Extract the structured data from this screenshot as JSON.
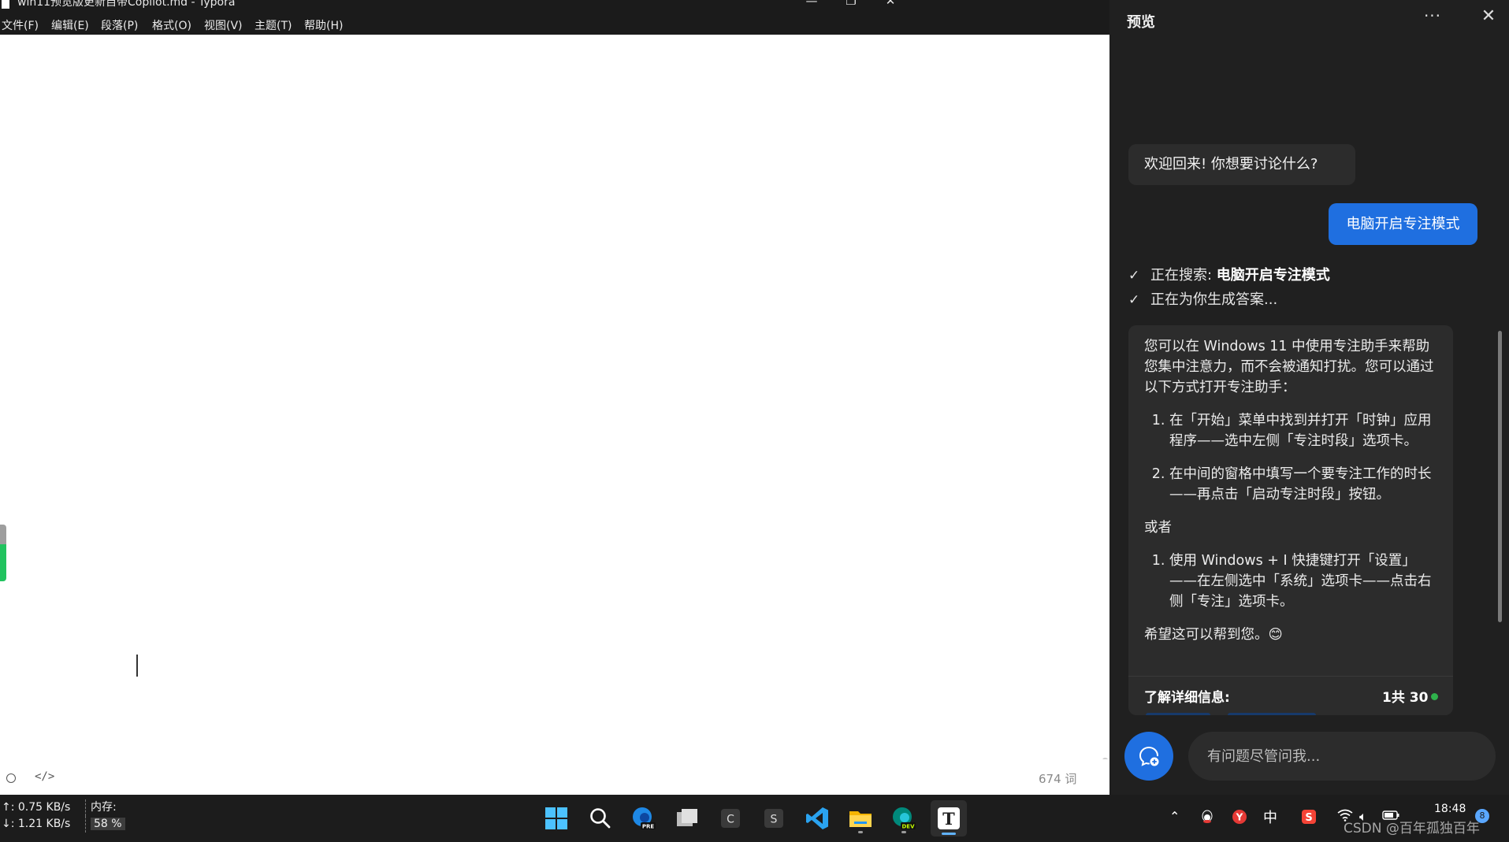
{
  "typora": {
    "title": "win11预览版更新自带Copilot.md - Typora",
    "window_buttons": {
      "minimize": "—",
      "restore": "❐",
      "close": "✕"
    },
    "menu": [
      "文件(F)",
      "编辑(E)",
      "段落(P)",
      "格式(O)",
      "视图(V)",
      "主题(T)",
      "帮助(H)"
    ],
    "word_count": "674 词",
    "code_toggle": "</>"
  },
  "copilot": {
    "title": "预览",
    "more": "···",
    "close": "✕",
    "welcome": "欢迎回来! 你想要讨论什么?",
    "user_message": "电脑开启专注模式",
    "status": {
      "searching_prefix": "正在搜索: ",
      "searching_query": "电脑开启专注模式",
      "generating": "正在为你生成答案..."
    },
    "answer": {
      "intro": "您可以在 Windows 11 中使用专注助手来帮助您集中注意力，而不会被通知打扰。您可以通过以下方式打开专注助手：",
      "list1": [
        "在「开始」菜单中找到并打开「时钟」应用程序——选中左侧「专注时段」选项卡。",
        "在中间的窗格中填写一个要专注工作的时长——再点击「启动专注时段」按钮。"
      ],
      "or": "或者",
      "list2": [
        "使用 Windows + I 快捷键打开「设置」——在左侧选中「系统」选项卡——点击右侧「专注」选项卡。"
      ],
      "closing": "希望这可以帮到您。😊",
      "learn_more": "了解详细信息:",
      "page_count": "1共 30"
    },
    "input_placeholder": "有问题尽管问我..."
  },
  "taskbar": {
    "net_up": "↑: 0.75 KB/s",
    "net_down": "↓: 1.21 KB/s",
    "mem_label": "内存:",
    "mem_value": "58 %",
    "ime": "中",
    "time": "18:48",
    "watermark": "CSDN @百年孤独百年",
    "notification_count": "8",
    "apps": [
      "windows-start-icon",
      "search-icon",
      "edge-preview-icon",
      "task-view-icon",
      "c-app-icon",
      "s-app-icon",
      "vscode-icon",
      "file-explorer-icon",
      "edge-dev-icon",
      "typora-icon"
    ]
  },
  "colors": {
    "copilot_bg": "#202020",
    "bubble_bg": "#2c2c2c",
    "user_bubble": "#1f6fe0",
    "taskbar_bg": "#1c1c1c"
  }
}
